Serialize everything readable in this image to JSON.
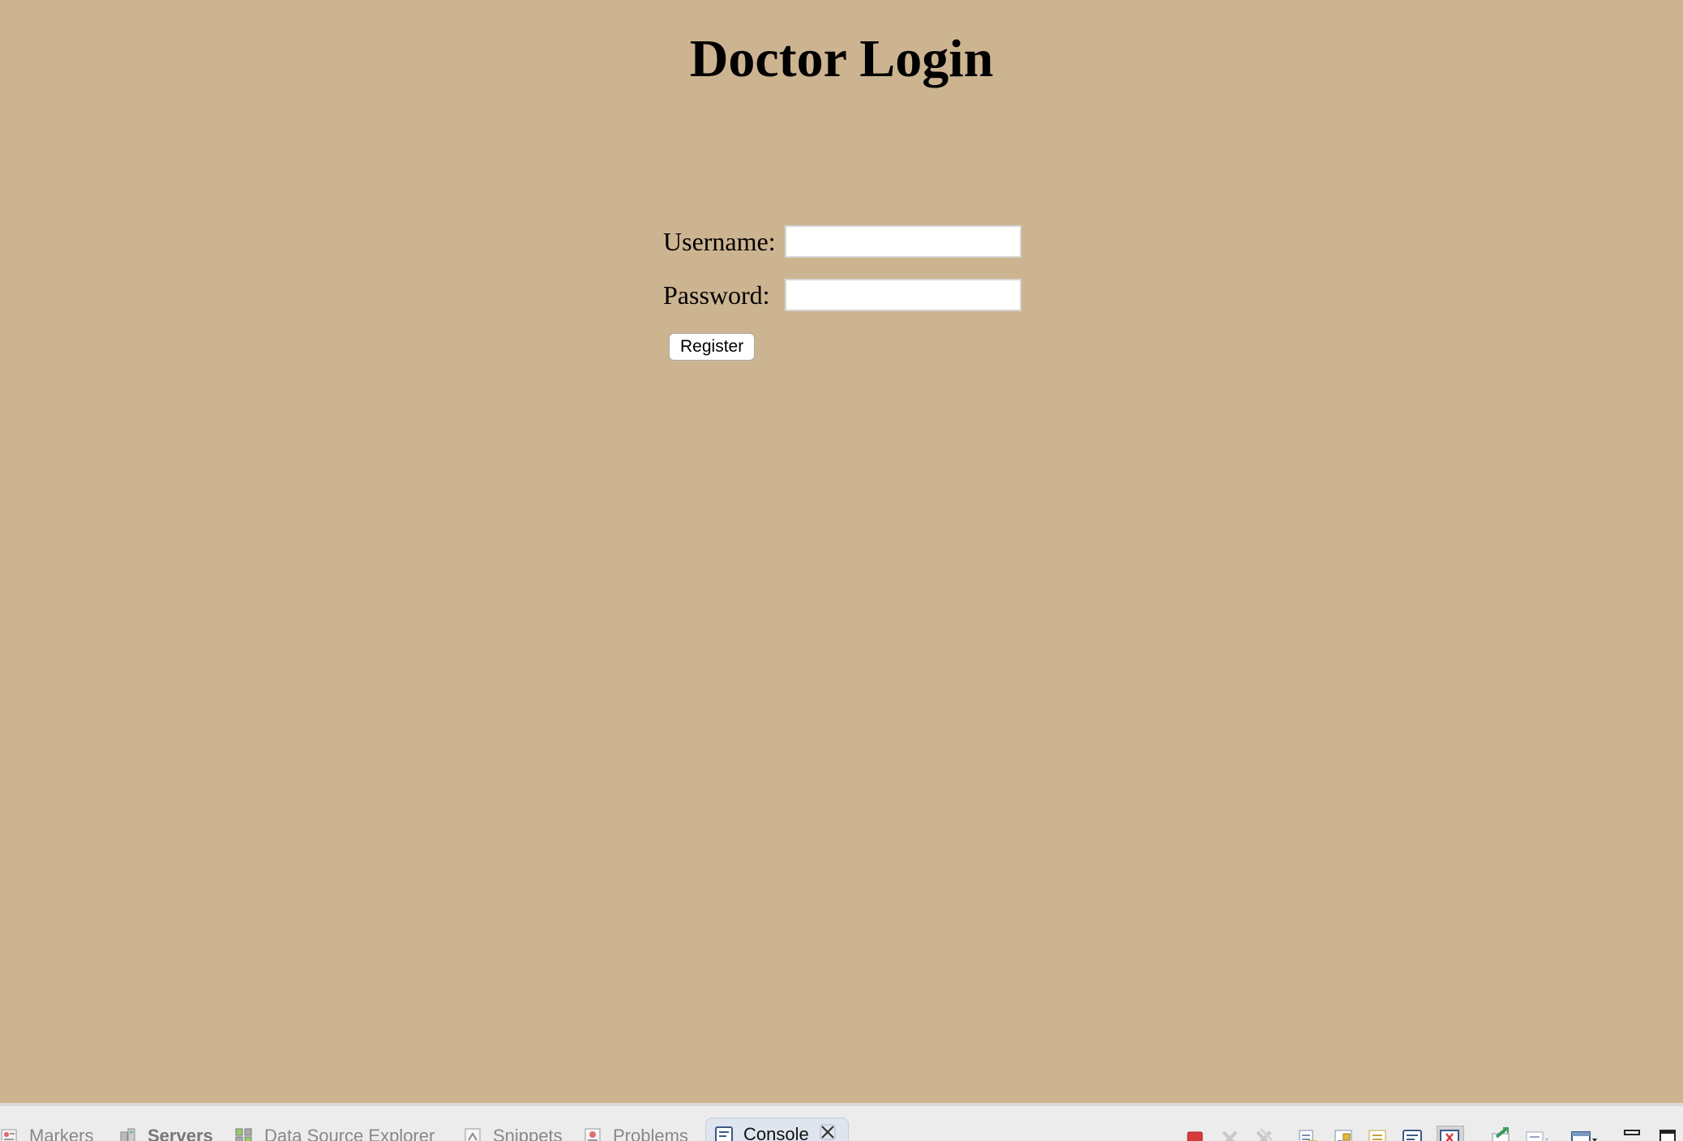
{
  "page": {
    "title": "Doctor Login"
  },
  "form": {
    "username_label": "Username:",
    "username_value": "",
    "password_label": "Password:",
    "password_value": "",
    "submit_label": "Register"
  },
  "ide_tabs": {
    "markers": "Markers",
    "servers": "Servers",
    "data_source_explorer": "Data Source Explorer",
    "snippets": "Snippets",
    "problems": "Problems",
    "console": "Console"
  },
  "colors": {
    "page_background": "#cdb491",
    "tab_bar_background": "#ececec",
    "active_tab_background": "#dfe5ee",
    "stop_button": "#d93a3a"
  }
}
